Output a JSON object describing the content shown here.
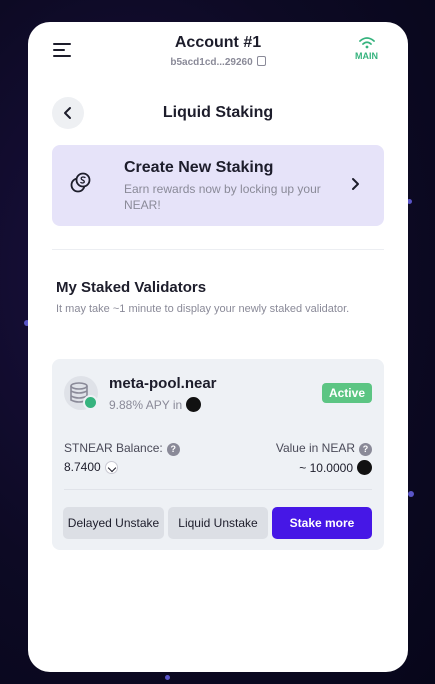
{
  "header": {
    "account_title": "Account #1",
    "account_id": "b5acd1cd...29260",
    "network": "MAIN"
  },
  "page": {
    "title": "Liquid Staking"
  },
  "create": {
    "title": "Create New Staking",
    "subtitle": "Earn rewards now by locking up your NEAR!"
  },
  "staked": {
    "title": "My Staked Validators",
    "subtitle": "It may take ~1 minute to display your newly staked validator."
  },
  "validator": {
    "name": "meta-pool.near",
    "apy": "9.88% APY in",
    "status": "Active",
    "balance_label": "STNEAR Balance:",
    "balance_value": "8.7400",
    "value_label": "Value in NEAR",
    "value_amount": "~ 10.0000"
  },
  "buttons": {
    "delayed_unstake": "Delayed Unstake",
    "liquid_unstake": "Liquid Unstake",
    "stake_more": "Stake more"
  },
  "colors": {
    "accent": "#4617e6",
    "active_badge": "#5cc583",
    "network_green": "#36b37e",
    "create_card_bg": "#e6e3f9"
  },
  "icons": {
    "menu": "menu-icon",
    "back": "chevron-left-icon",
    "create": "coins-icon",
    "chevron": "chevron-right-icon",
    "network": "wifi-icon",
    "copy": "copy-icon",
    "help": "help-icon",
    "near": "near-logo-icon",
    "stnear": "stnear-logo-icon"
  }
}
